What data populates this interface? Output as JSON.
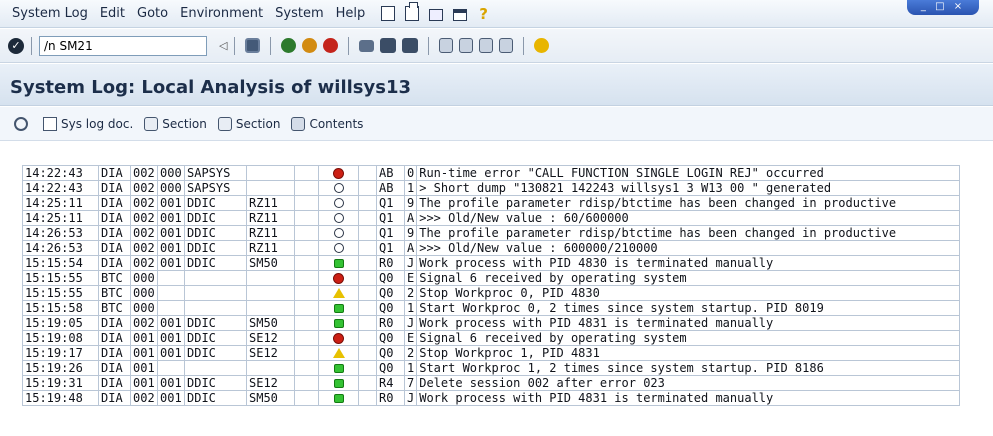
{
  "menubar": {
    "items": [
      "System Log",
      "Edit",
      "Goto",
      "Environment",
      "System",
      "Help"
    ],
    "help_glyph": "?",
    "window_controls": "_ □ ×"
  },
  "toolbar": {
    "command_value": "/n SM21",
    "arrow_glyph": "◁"
  },
  "title": "System Log: Local Analysis of willsys13",
  "app_toolbar": {
    "buttons": [
      "",
      "Sys log doc.",
      "Section",
      "Section",
      "Contents"
    ]
  },
  "log": {
    "rows": [
      {
        "time": "14:22:43",
        "task": "DIA",
        "cl": "002",
        "no": "000",
        "user": "SAPSYS",
        "tcode": "",
        "status": "red",
        "mid": "AB",
        "num": "0",
        "text": "Run-time error \"CALL FUNCTION SINGLE LOGIN REJ\" occurred"
      },
      {
        "time": "14:22:43",
        "task": "DIA",
        "cl": "002",
        "no": "000",
        "user": "SAPSYS",
        "tcode": "",
        "status": "empty",
        "mid": "AB",
        "num": "1",
        "text": "> Short dump \"130821 142243 willsys1 3 W13 00 \" generated"
      },
      {
        "time": "14:25:11",
        "task": "DIA",
        "cl": "002",
        "no": "001",
        "user": "DDIC",
        "tcode": "RZ11",
        "status": "empty",
        "mid": "Q1",
        "num": "9",
        "text": "The profile parameter rdisp/btctime has been changed in productive"
      },
      {
        "time": "14:25:11",
        "task": "DIA",
        "cl": "002",
        "no": "001",
        "user": "DDIC",
        "tcode": "RZ11",
        "status": "empty",
        "mid": "Q1",
        "num": "A",
        "text": ">>> Old/New value : 60/600000"
      },
      {
        "time": "14:26:53",
        "task": "DIA",
        "cl": "002",
        "no": "001",
        "user": "DDIC",
        "tcode": "RZ11",
        "status": "empty",
        "mid": "Q1",
        "num": "9",
        "text": "The profile parameter rdisp/btctime has been changed in productive"
      },
      {
        "time": "14:26:53",
        "task": "DIA",
        "cl": "002",
        "no": "001",
        "user": "DDIC",
        "tcode": "RZ11",
        "status": "empty",
        "mid": "Q1",
        "num": "A",
        "text": ">>> Old/New value : 600000/210000"
      },
      {
        "time": "15:15:54",
        "task": "DIA",
        "cl": "002",
        "no": "001",
        "user": "DDIC",
        "tcode": "SM50",
        "status": "green",
        "mid": "R0",
        "num": "J",
        "text": "Work process with PID 4830 is terminated manually"
      },
      {
        "time": "15:15:55",
        "task": "BTC",
        "cl": "000",
        "no": "",
        "user": "",
        "tcode": "",
        "status": "red",
        "mid": "Q0",
        "num": "E",
        "text": "Signal 6 received by operating system"
      },
      {
        "time": "15:15:55",
        "task": "BTC",
        "cl": "000",
        "no": "",
        "user": "",
        "tcode": "",
        "status": "yellow",
        "mid": "Q0",
        "num": "2",
        "text": "Stop Workproc 0, PID 4830"
      },
      {
        "time": "15:15:58",
        "task": "BTC",
        "cl": "000",
        "no": "",
        "user": "",
        "tcode": "",
        "status": "green",
        "mid": "Q0",
        "num": "1",
        "text": "Start Workproc 0, 2 times since system startup. PID 8019"
      },
      {
        "time": "15:19:05",
        "task": "DIA",
        "cl": "002",
        "no": "001",
        "user": "DDIC",
        "tcode": "SM50",
        "status": "green",
        "mid": "R0",
        "num": "J",
        "text": "Work process with PID 4831 is terminated manually"
      },
      {
        "time": "15:19:08",
        "task": "DIA",
        "cl": "001",
        "no": "001",
        "user": "DDIC",
        "tcode": "SE12",
        "status": "red",
        "mid": "Q0",
        "num": "E",
        "text": "Signal 6 received by operating system"
      },
      {
        "time": "15:19:17",
        "task": "DIA",
        "cl": "001",
        "no": "001",
        "user": "DDIC",
        "tcode": "SE12",
        "status": "yellow",
        "mid": "Q0",
        "num": "2",
        "text": "Stop Workproc 1, PID 4831"
      },
      {
        "time": "15:19:26",
        "task": "DIA",
        "cl": "001",
        "no": "",
        "user": "",
        "tcode": "",
        "status": "green",
        "mid": "Q0",
        "num": "1",
        "text": "Start Workproc 1, 2 times since system startup. PID 8186"
      },
      {
        "time": "15:19:31",
        "task": "DIA",
        "cl": "001",
        "no": "001",
        "user": "DDIC",
        "tcode": "SE12",
        "status": "green",
        "mid": "R4",
        "num": "7",
        "text": "Delete session 002 after error 023"
      },
      {
        "time": "15:19:48",
        "task": "DIA",
        "cl": "002",
        "no": "001",
        "user": "DDIC",
        "tcode": "SM50",
        "status": "green",
        "mid": "R0",
        "num": "J",
        "text": "Work process with PID 4831 is terminated manually",
        "selected": true
      }
    ]
  }
}
